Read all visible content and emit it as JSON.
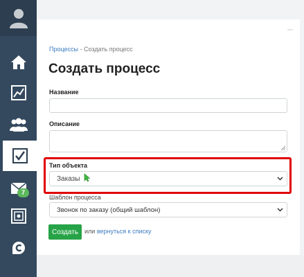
{
  "breadcrumb": {
    "parent": "Процессы",
    "separator": " - ",
    "current": "Создать процесс"
  },
  "page_title": "Создать процесс",
  "form": {
    "name_label": "Название",
    "name_value": "",
    "description_label": "Описание",
    "description_value": "",
    "object_type_label": "Тип объекта",
    "object_type_value": "Заказы",
    "template_label": "Шаблон процесса",
    "template_value": "Звонок по заказу (общий шаблон)"
  },
  "actions": {
    "create_label": "Создать",
    "or_text": "или",
    "back_link": "вернуться к списку"
  },
  "sidebar": {
    "items": [
      {
        "icon": "user-avatar-icon"
      },
      {
        "icon": "home-icon"
      },
      {
        "icon": "chart-icon"
      },
      {
        "icon": "users-group-icon"
      },
      {
        "icon": "checkbox-icon",
        "active": true
      },
      {
        "icon": "mail-icon",
        "badge": "7"
      },
      {
        "icon": "safe-icon"
      },
      {
        "icon": "c-logo-icon"
      }
    ]
  },
  "colors": {
    "sidebar": "#34495e",
    "accent": "#27a347",
    "highlight": "#e00000",
    "link": "#3b7bbf"
  }
}
